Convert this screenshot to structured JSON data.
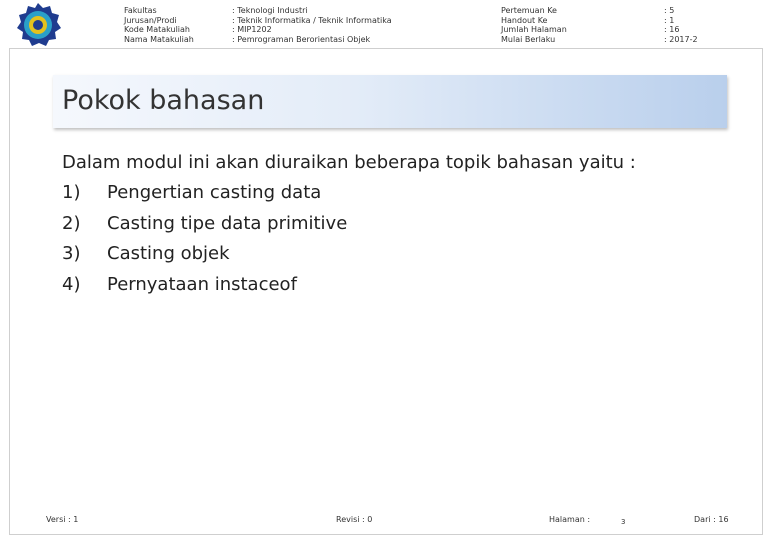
{
  "header": {
    "labels": [
      "Fakultas",
      "Jurusan/Prodi",
      "Kode Matakuliah",
      "Nama Matakuliah"
    ],
    "values": [
      ": Teknologi Industri",
      ": Teknik Informatika / Teknik Informatika",
      ": MIP1202",
      ": Pemrograman Berorientasi Objek"
    ],
    "right_labels": [
      "Pertemuan Ke",
      "Handout Ke",
      "Jumlah Halaman",
      "Mulai Berlaku"
    ],
    "right_values": [
      ": 5",
      ": 1",
      ": 16",
      ": 2017-2"
    ]
  },
  "logo": {
    "icon": "university-seal-icon",
    "colors": {
      "outer": "#1f3c8f",
      "inner": "#2aa0c8",
      "accent": "#e3c21e"
    }
  },
  "banner": {
    "title": "Pokok bahasan"
  },
  "content": {
    "intro": "Dalam modul ini akan diuraikan beberapa topik bahasan yaitu :",
    "items": [
      {
        "num": "1)",
        "text": "Pengertian casting data"
      },
      {
        "num": "2)",
        "text": "Casting tipe data primitive"
      },
      {
        "num": "3)",
        "text": "Casting objek"
      },
      {
        "num": "4)",
        "text": "Pernyataan instaceof"
      }
    ]
  },
  "footer": {
    "versi": "Versi : 1",
    "revisi": "Revisi : 0",
    "halaman_label": "Halaman :",
    "halaman_value": "3",
    "dari": "Dari : 16"
  }
}
